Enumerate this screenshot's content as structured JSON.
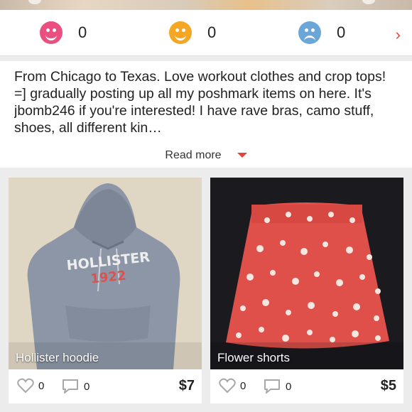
{
  "ratings": {
    "positive": {
      "count": "0",
      "color": "#ea4f7f"
    },
    "neutral": {
      "count": "0",
      "color": "#f5a623"
    },
    "negative": {
      "count": "0",
      "color": "#6aa6d8"
    },
    "more_icon": "chevron-right-icon"
  },
  "bio": {
    "text": "From Chicago to Texas. Love workout clothes and crop tops! =] gradually posting up all my poshmark items on here. It's jbomb246 if you're interested! I have rave bras, camo stuff, shoes, all different kin…",
    "read_more_label": "Read more"
  },
  "listings": [
    {
      "title": "Hollister hoodie",
      "likes": "0",
      "comments": "0",
      "price": "$7"
    },
    {
      "title": "Flower shorts",
      "likes": "0",
      "comments": "0",
      "price": "$5"
    }
  ]
}
